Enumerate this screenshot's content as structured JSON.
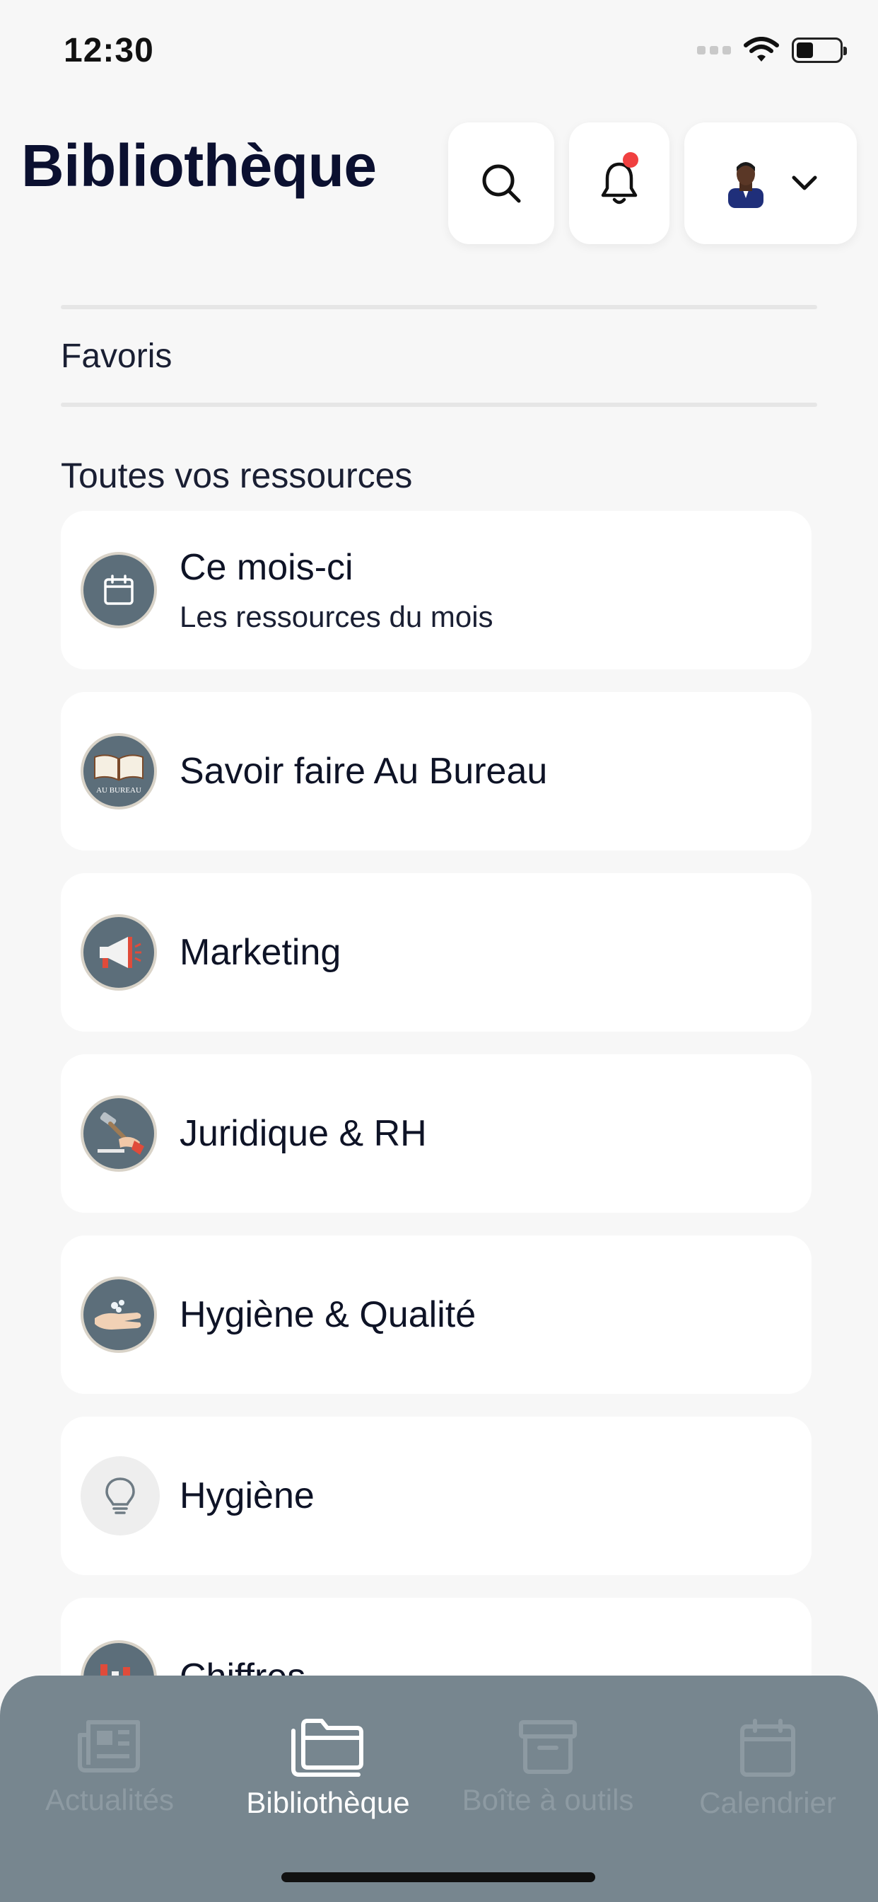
{
  "status_bar": {
    "time": "12:30",
    "icons": [
      "signal-icon",
      "wifi-icon",
      "battery-icon"
    ],
    "battery_level": 0.4
  },
  "header": {
    "title": "Bibliothèque",
    "buttons": [
      "search-icon",
      "bell-icon",
      "avatar",
      "chevron-down-icon"
    ],
    "has_notification": true,
    "notification_color": "#f04040"
  },
  "favorites": {
    "label": "Favoris"
  },
  "resources": {
    "title": "Toutes vos ressources",
    "items": [
      {
        "title": "Ce mois-ci",
        "subtitle": "Les ressources du mois",
        "icon": "calendar-icon"
      },
      {
        "title": "Savoir faire Au Bureau",
        "icon": "book-icon",
        "icon_text": "AU BUREAU"
      },
      {
        "title": "Marketing",
        "icon": "megaphone-icon"
      },
      {
        "title": "Juridique & RH",
        "icon": "gavel-icon"
      },
      {
        "title": "Hygiène & Qualité",
        "icon": "hand-wash-icon"
      },
      {
        "title": "Hygiène",
        "icon": "lightbulb-icon"
      },
      {
        "title": "Chiffres",
        "icon": "chart-icon"
      }
    ]
  },
  "bottom_nav": {
    "items": [
      {
        "label": "Actualités",
        "icon": "newspaper-icon",
        "active": false
      },
      {
        "label": "Bibliothèque",
        "icon": "folders-icon",
        "active": true
      },
      {
        "label": "Boîte à outils",
        "icon": "archive-box-icon",
        "active": false
      },
      {
        "label": "Calendrier",
        "icon": "calendar-icon",
        "active": false
      }
    ]
  },
  "colors": {
    "background": "#f7f7f7",
    "card": "#ffffff",
    "nav_background": "#77868f",
    "nav_active": "#ffffff",
    "nav_inactive": "#8d9aa2",
    "icon_circle": "#5c6e7a"
  }
}
